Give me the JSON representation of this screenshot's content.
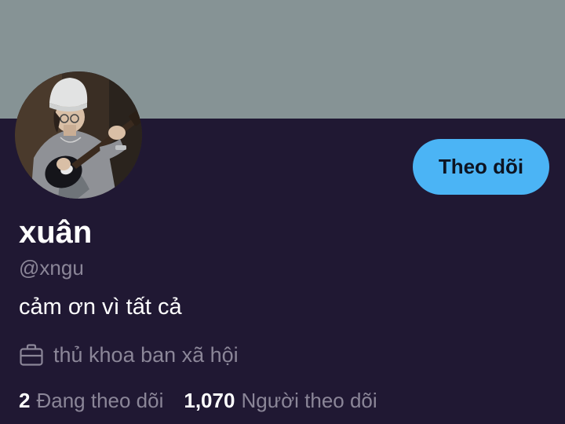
{
  "profile": {
    "display_name": "xuân",
    "handle": "@xngu",
    "bio": "cảm ơn vì tất cả",
    "work": {
      "icon": "briefcase-icon",
      "text": "thủ khoa ban xã hội"
    },
    "stats": {
      "following_count": "2",
      "following_label": "Đang theo dõi",
      "followers_count": "1,070",
      "followers_label": "Người theo dõi"
    }
  },
  "actions": {
    "follow_label": "Theo dõi"
  },
  "colors": {
    "banner": "#869395",
    "background": "#201833",
    "accent": "#4bb4f5",
    "muted_text": "#8b8698"
  }
}
